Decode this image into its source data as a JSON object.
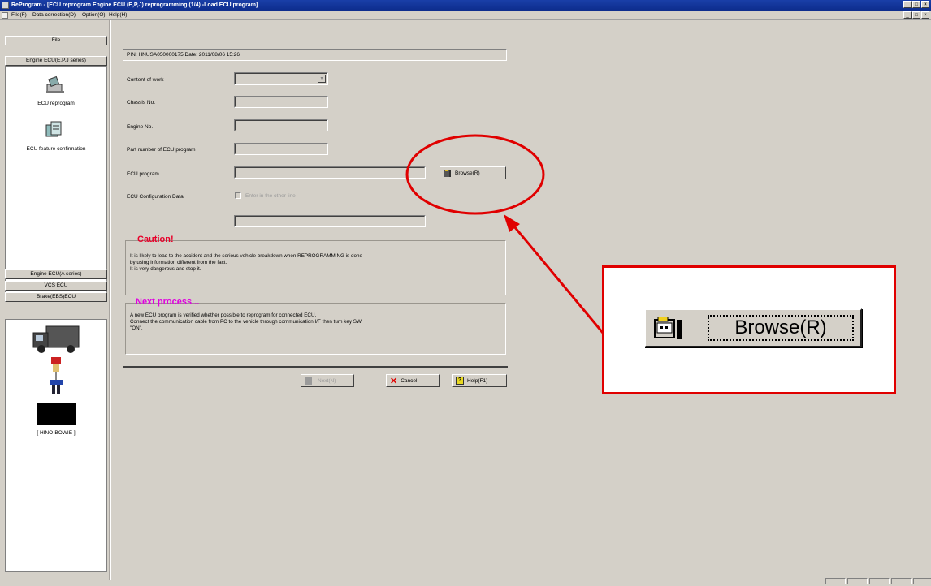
{
  "window": {
    "title": "ReProgram - [ECU reprogram Engine ECU (E,P,J) reprogramming (1/4) -Load ECU program]",
    "controls": [
      "_",
      "□",
      "×"
    ]
  },
  "menu": {
    "items": [
      "File(F)",
      "Data correction(D)",
      "Option(O)",
      "Help(H)"
    ]
  },
  "sidebar": {
    "file_label": "File",
    "engine_ecu_epj": "Engine ECU(E,P,J series)",
    "nav": [
      {
        "label": "ECU reprogram",
        "icon": "ecu-reprogram-icon"
      },
      {
        "label": "ECU feature confirmation",
        "icon": "ecu-feature-icon"
      }
    ],
    "engine_ecu_a": "Engine ECU(A series)",
    "vcs_ecu": "VCS ECU",
    "brake_ecu": "Brake(EBS)ECU",
    "device_label": "[ HINO-BOWIE ]"
  },
  "form": {
    "pin_date": "PIN: HNUSA050000175  Date: 2011/08/06 15:26",
    "content_of_work_label": "Content of work",
    "chassis_label": "Chassis No.",
    "engine_label": "Engine No.",
    "part_number_label": "Part number of ECU program",
    "ecu_program_label": "ECU program",
    "ecu_config_label": "ECU Configuration Data",
    "config_checkbox_label": "Enter in the other line",
    "browse_label": "Browse(R)"
  },
  "caution": {
    "title": "Caution!",
    "text": "It is likely to lead to the accident and the serious vehicle breakdown when REPROGRAMMING is done\nby using information different from the fact.\nIt is very dangerous and stop it."
  },
  "next_process": {
    "title": "Next process...",
    "text": "A new ECU program is verified whether possible to reprogram for connected ECU.\nConnect the communication cable from PC to the vehicle through communication I/F then turn key SW\n\"ON\"."
  },
  "buttons": {
    "next": "Next(N)",
    "cancel": "Cancel",
    "help": "Help(F1)"
  },
  "zoom_callout": {
    "browse_label": "Browse(R)"
  },
  "colors": {
    "caution": "#e8002a",
    "next_process": "#e000e0",
    "annotation": "#e00000",
    "titlebar": "#0d2c8c"
  }
}
